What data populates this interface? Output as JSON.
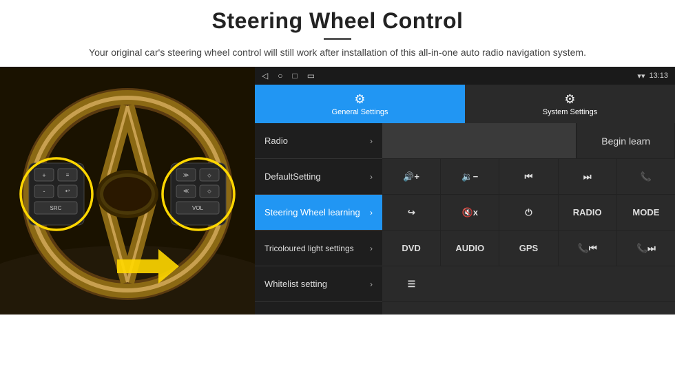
{
  "page": {
    "title": "Steering Wheel Control",
    "divider": true,
    "subtitle": "Your original car's steering wheel control will still work after installation of this all-in-one auto radio navigation system."
  },
  "status_bar": {
    "back_icon": "◁",
    "home_icon": "○",
    "recents_icon": "□",
    "screen_icon": "▭",
    "signal_icon": "▾",
    "wifi_icon": "▾",
    "time": "13:13"
  },
  "tabs": [
    {
      "id": "general",
      "label": "General Settings",
      "icon": "⚙",
      "active": true
    },
    {
      "id": "system",
      "label": "System Settings",
      "icon": "⚙",
      "active": false
    }
  ],
  "menu_items": [
    {
      "id": "radio",
      "label": "Radio",
      "active": false
    },
    {
      "id": "default",
      "label": "DefaultSetting",
      "active": false
    },
    {
      "id": "steering",
      "label": "Steering Wheel learning",
      "active": true
    },
    {
      "id": "tricoloured",
      "label": "Tricoloured light settings",
      "active": false
    },
    {
      "id": "whitelist",
      "label": "Whitelist setting",
      "active": false
    }
  ],
  "controls": {
    "begin_learn_label": "Begin learn",
    "row1": [
      {
        "id": "vol_up",
        "label": "🔊+",
        "icon": "vol-up-icon"
      },
      {
        "id": "vol_down",
        "label": "🔉-",
        "icon": "vol-down-icon"
      },
      {
        "id": "prev",
        "label": "⏮",
        "icon": "prev-icon"
      },
      {
        "id": "next",
        "label": "⏭",
        "icon": "next-icon"
      },
      {
        "id": "phone",
        "label": "📞",
        "icon": "phone-icon"
      }
    ],
    "row2": [
      {
        "id": "hangup",
        "label": "↩",
        "icon": "hangup-icon"
      },
      {
        "id": "mute",
        "label": "🔇x",
        "icon": "mute-icon"
      },
      {
        "id": "power",
        "label": "⏻",
        "icon": "power-icon"
      },
      {
        "id": "radio_btn",
        "label": "RADIO",
        "icon": "radio-icon"
      },
      {
        "id": "mode",
        "label": "MODE",
        "icon": "mode-icon"
      }
    ],
    "row3": [
      {
        "id": "dvd",
        "label": "DVD",
        "icon": "dvd-icon"
      },
      {
        "id": "audio",
        "label": "AUDIO",
        "icon": "audio-icon"
      },
      {
        "id": "gps",
        "label": "GPS",
        "icon": "gps-icon"
      },
      {
        "id": "tel_prev",
        "label": "📞⏮",
        "icon": "tel-prev-icon"
      },
      {
        "id": "tel_next",
        "label": "📞⏭",
        "icon": "tel-next-icon"
      }
    ],
    "row4": [
      {
        "id": "menu_btn",
        "label": "☰",
        "icon": "menu-icon"
      }
    ]
  }
}
